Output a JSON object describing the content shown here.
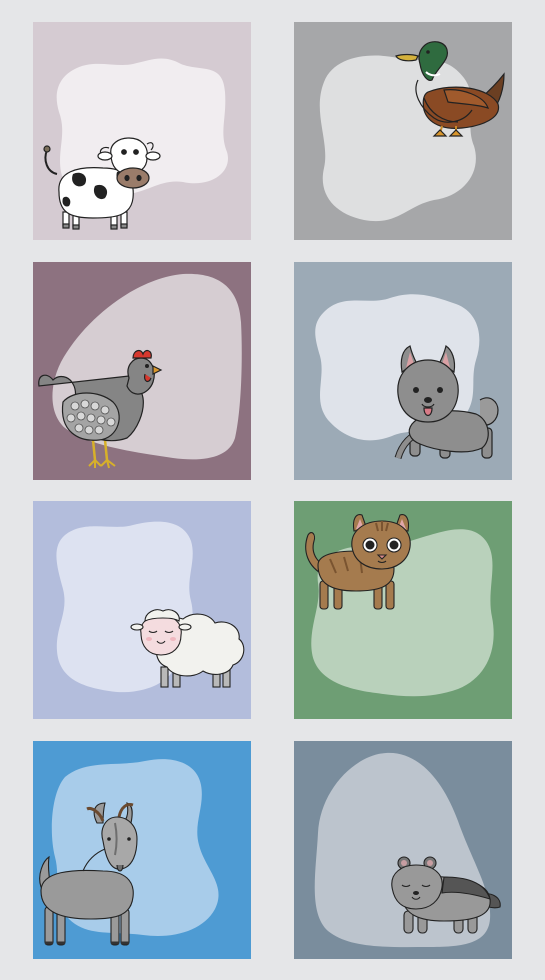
{
  "cards": [
    {
      "animal": "cow",
      "background": "#d5cbd2",
      "blob": "#f1edf0"
    },
    {
      "animal": "duck",
      "background": "#a6a7a9",
      "blob": "#dedfe0"
    },
    {
      "animal": "hen",
      "background": "#8d7280",
      "blob": "#d6cdd2"
    },
    {
      "animal": "dog",
      "background": "#9caab6",
      "blob": "#dfe3ea"
    },
    {
      "animal": "sheep",
      "background": "#b3bddc",
      "blob": "#dde2f1"
    },
    {
      "animal": "cat",
      "background": "#6e9e74",
      "blob": "#b9d1bb"
    },
    {
      "animal": "goat",
      "background": "#4e9bd3",
      "blob": "#a8ccea"
    },
    {
      "animal": "hamster",
      "background": "#7a8d9d",
      "blob": "#bcc4cd"
    }
  ]
}
